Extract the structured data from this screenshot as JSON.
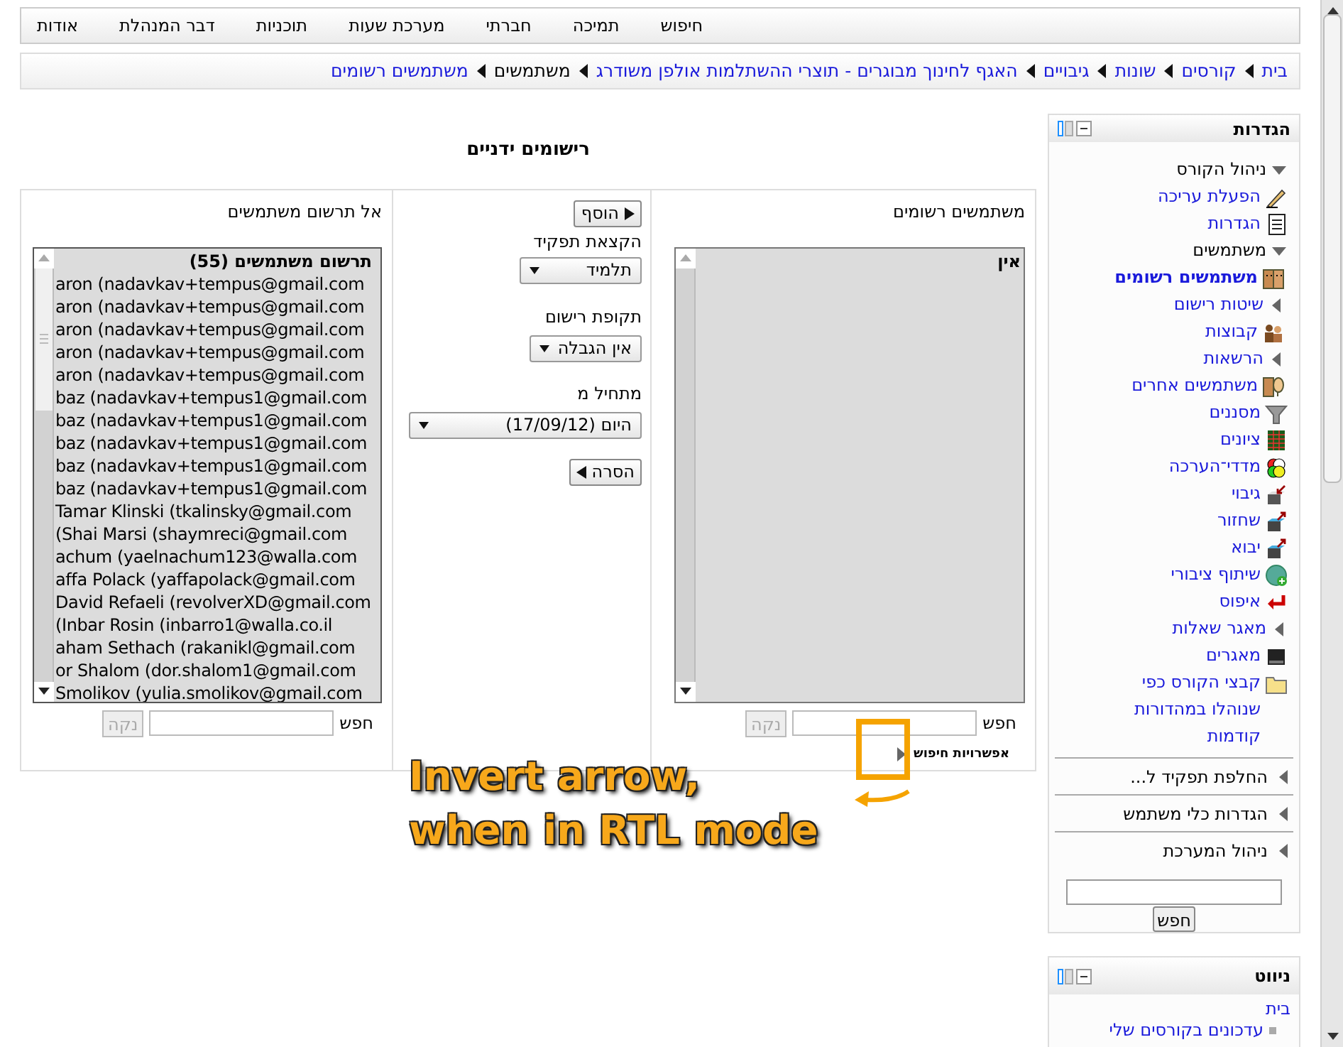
{
  "top_nav": [
    {
      "label": "חיפוש"
    },
    {
      "label": "תמיכה"
    },
    {
      "label": "חברתי"
    },
    {
      "label": "מערכת שעות"
    },
    {
      "label": "תוכניות"
    },
    {
      "label": "דבר המנהלת"
    },
    {
      "label": "אודות"
    }
  ],
  "breadcrumb": [
    {
      "label": "בית",
      "link": true
    },
    {
      "label": "קורסים",
      "link": true
    },
    {
      "label": "שונות",
      "link": true
    },
    {
      "label": "גיבויים",
      "link": true
    },
    {
      "label": "האגף לחינוך מבוגרים - תוצרי ההשתלמות אולפן משודרג",
      "link": true
    },
    {
      "label": "משתמשים",
      "link": false
    },
    {
      "label": "משתמשים רשומים",
      "link": true
    }
  ],
  "page_title": "רישומים ידניים",
  "enrolled": {
    "label": "משתמשים רשומים",
    "options": [
      {
        "label": "אין"
      }
    ],
    "search_label": "חפש",
    "clear_button": {
      "label": "נקה",
      "disabled": true
    },
    "search_options": {
      "label": "אפשרויות חיפוש",
      "expanded": false
    }
  },
  "controls": {
    "add_button": "הוסף",
    "role_label": "הקצאת תפקיד",
    "role_value": "תלמיד",
    "period_label": "תקופת רישום",
    "period_value": "אין הגבלה",
    "start_label": "מתחיל מ",
    "start_value": "היום (17/09/12)",
    "remove_button": "הסרה"
  },
  "not_enrolled": {
    "label": "אל תרשום משתמשים",
    "group": "תרשום משתמשים (55)",
    "options": [
      {
        "label": "aron (nadavkav+tempus@gmail.com"
      },
      {
        "label": "aron (nadavkav+tempus@gmail.com"
      },
      {
        "label": "aron (nadavkav+tempus@gmail.com"
      },
      {
        "label": "aron (nadavkav+tempus@gmail.com"
      },
      {
        "label": "aron (nadavkav+tempus@gmail.com"
      },
      {
        "label": "baz (nadavkav+tempus1@gmail.com"
      },
      {
        "label": "baz (nadavkav+tempus1@gmail.com"
      },
      {
        "label": "baz (nadavkav+tempus1@gmail.com"
      },
      {
        "label": "baz (nadavkav+tempus1@gmail.com"
      },
      {
        "label": "baz (nadavkav+tempus1@gmail.com"
      },
      {
        "label": "Tamar Klinski (tkalinsky@gmail.com"
      },
      {
        "label": "(Shai Marsi (shaymreci@gmail.com"
      },
      {
        "label": "achum (yaelnachum123@walla.com"
      },
      {
        "label": "affa Polack (yaffapolack@gmail.com"
      },
      {
        "label": "David Refaeli (revolverXD@gmail.com"
      },
      {
        "label": "(Inbar Rosin (inbarro1@walla.co.il"
      },
      {
        "label": "aham Sethach (rakanikl@gmail.com"
      },
      {
        "label": "or Shalom (dor.shalom1@gmail.com"
      },
      {
        "label": "Smolikov (yulia.smolikov@gmail.com"
      }
    ],
    "search_label": "חפש",
    "clear_button": {
      "label": "נקה",
      "disabled": true
    }
  },
  "settings_block": {
    "title": "הגדרות",
    "tree": [
      {
        "label": "ניהול הקורס",
        "kind": "node",
        "link": false,
        "expanded": true,
        "children": [
          {
            "label": "הפעלת עריכה",
            "kind": "leaf",
            "selected": false
          },
          {
            "label": "הגדרות",
            "kind": "leaf",
            "selected": false
          },
          {
            "label": "משתמשים",
            "kind": "node",
            "link": false,
            "expanded": true,
            "children": [
              {
                "label": "משתמשים רשומים",
                "kind": "leaf",
                "selected": true
              },
              {
                "label": "שיטות רישום",
                "kind": "node",
                "link": true,
                "expanded": false
              },
              {
                "label": "קבוצות",
                "kind": "leaf",
                "selected": false
              },
              {
                "label": "הרשאות",
                "kind": "node",
                "link": true,
                "expanded": false
              },
              {
                "label": "משתמשים אחרים",
                "kind": "leaf",
                "selected": false
              }
            ]
          },
          {
            "label": "מסננים",
            "kind": "leaf",
            "selected": false
          },
          {
            "label": "ציונים",
            "kind": "leaf",
            "selected": false
          },
          {
            "label": "מדדי־הערכה",
            "kind": "leaf",
            "selected": false
          },
          {
            "label": "גיבוי",
            "kind": "leaf",
            "selected": false
          },
          {
            "label": "שחזור",
            "kind": "leaf",
            "selected": false
          },
          {
            "label": "יבוא",
            "kind": "leaf",
            "selected": false
          },
          {
            "label": "שיתוף ציבורי",
            "kind": "leaf",
            "selected": false
          },
          {
            "label": "איפוס",
            "kind": "leaf",
            "selected": false
          },
          {
            "label": "מאגר שאלות",
            "kind": "node",
            "link": true,
            "expanded": false
          },
          {
            "label": "מאגרים",
            "kind": "leaf",
            "selected": false
          },
          {
            "label": "קבצי הקורס כפי שנוהלו במהדורות קודמות",
            "kind": "leaf",
            "selected": false
          }
        ]
      }
    ],
    "sections": [
      {
        "label": "החלפת תפקיד ל...",
        "expanded": false
      },
      {
        "label": "הגדרות כלי משתמש",
        "expanded": false
      },
      {
        "label": "ניהול המערכת",
        "expanded": false
      }
    ],
    "search_button": "חפש"
  },
  "navigation_block": {
    "title": "ניווט",
    "items": [
      {
        "label": "בית"
      },
      {
        "label": "עדכונים בקורסים שלי"
      }
    ]
  },
  "annotation": {
    "lines": [
      "Invert arrow,",
      "when in RTL mode"
    ]
  }
}
